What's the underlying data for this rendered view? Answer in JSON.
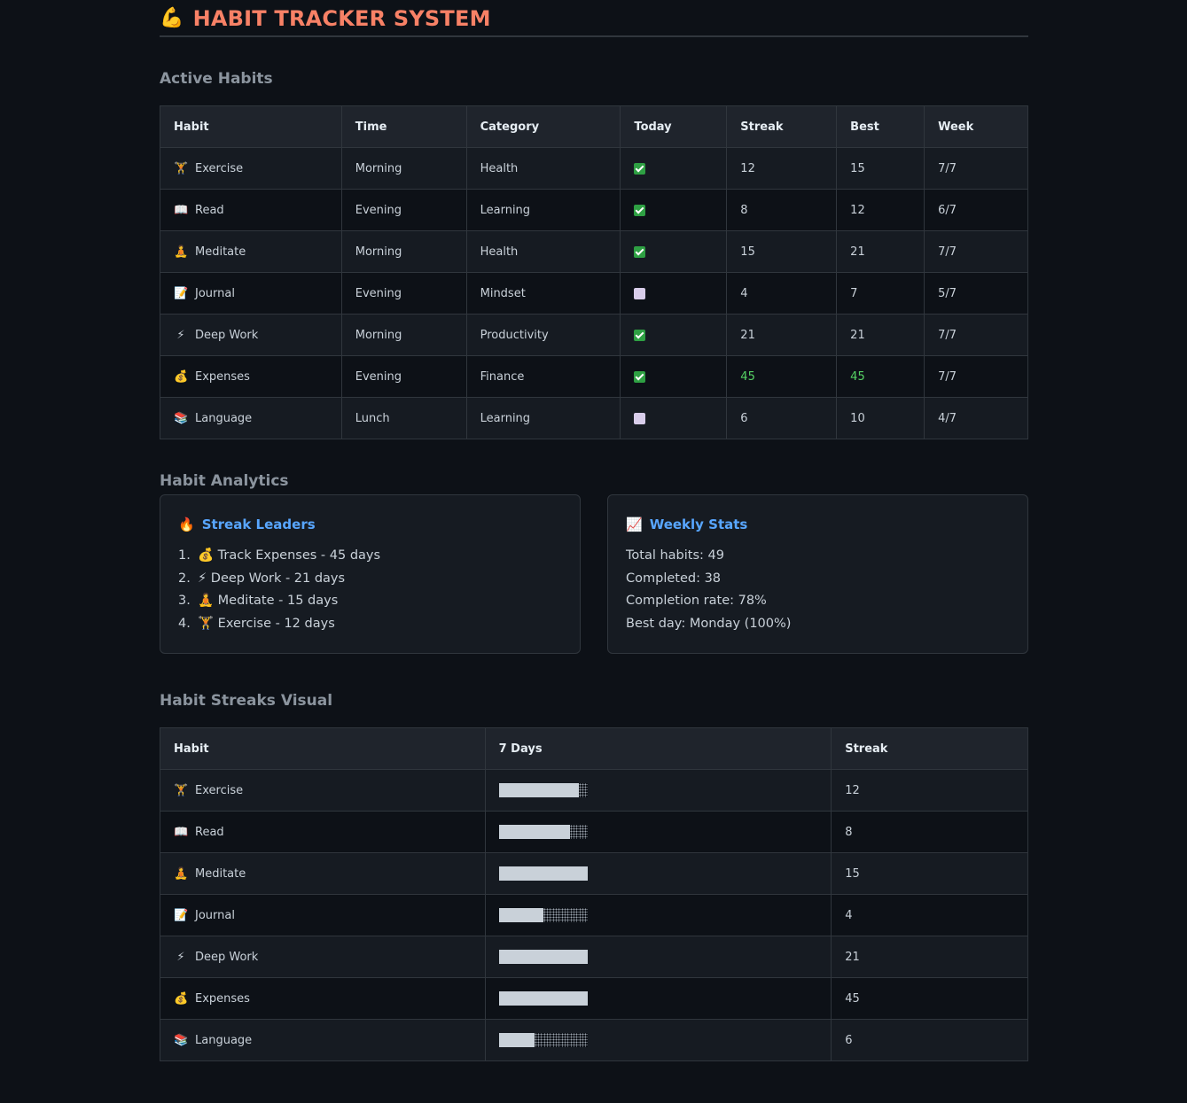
{
  "header": {
    "emoji": "💪",
    "title": "HABIT TRACKER SYSTEM"
  },
  "active_habits": {
    "section_title": "Active Habits",
    "columns": [
      "Habit",
      "Time",
      "Category",
      "Today",
      "Streak",
      "Best",
      "Week"
    ],
    "rows": [
      {
        "icon": "🏋️",
        "icon_name": "weightlifter-icon",
        "habit": "Exercise",
        "time": "Morning",
        "category": "Health",
        "today": "done",
        "streak": "12",
        "best": "15",
        "week": "7/7"
      },
      {
        "icon": "📖",
        "icon_name": "book-icon",
        "habit": "Read",
        "time": "Evening",
        "category": "Learning",
        "today": "done",
        "streak": "8",
        "best": "12",
        "week": "6/7"
      },
      {
        "icon": "🧘",
        "icon_name": "meditation-icon",
        "habit": "Meditate",
        "time": "Morning",
        "category": "Health",
        "today": "done",
        "streak": "15",
        "best": "21",
        "week": "7/7"
      },
      {
        "icon": "📝",
        "icon_name": "memo-icon",
        "habit": "Journal",
        "time": "Evening",
        "category": "Mindset",
        "today": "todo",
        "streak": "4",
        "best": "7",
        "week": "5/7"
      },
      {
        "icon": "⚡",
        "icon_name": "lightning-icon",
        "habit": "Deep Work",
        "time": "Morning",
        "category": "Productivity",
        "today": "done",
        "streak": "21",
        "best": "21",
        "week": "7/7"
      },
      {
        "icon": "💰",
        "icon_name": "money-bag-icon",
        "habit": "Expenses",
        "time": "Evening",
        "category": "Finance",
        "today": "done",
        "streak": "45",
        "best": "45",
        "week": "7/7",
        "highlight": true
      },
      {
        "icon": "📚",
        "icon_name": "books-icon",
        "habit": "Language",
        "time": "Lunch",
        "category": "Learning",
        "today": "todo",
        "streak": "6",
        "best": "10",
        "week": "4/7"
      }
    ]
  },
  "analytics": {
    "section_title": "Habit Analytics",
    "streak_leaders": {
      "icon": "🔥",
      "title": "Streak Leaders",
      "items": [
        {
          "num": "1.",
          "icon": "💰",
          "icon_name": "money-bag-icon",
          "text": "Track Expenses - 45 days"
        },
        {
          "num": "2.",
          "icon": "⚡",
          "icon_name": "lightning-icon",
          "text": "Deep Work - 21 days"
        },
        {
          "num": "3.",
          "icon": "🧘",
          "icon_name": "meditation-icon",
          "text": "Meditate - 15 days"
        },
        {
          "num": "4.",
          "icon": "🏋️",
          "icon_name": "weightlifter-icon",
          "text": "Exercise - 12 days"
        }
      ]
    },
    "weekly_stats": {
      "icon": "📈",
      "title": "Weekly Stats",
      "lines": [
        "Total habits: 49",
        "Completed: 38",
        "Completion rate: 78%",
        "Best day: Monday (100%)"
      ]
    }
  },
  "streaks_visual": {
    "section_title": "Habit Streaks Visual",
    "columns": [
      "Habit",
      "7 Days",
      "Streak"
    ],
    "rows": [
      {
        "icon": "🏋️",
        "icon_name": "weightlifter-icon",
        "habit": "Exercise",
        "filled": 9,
        "total": 10,
        "streak": "12"
      },
      {
        "icon": "📖",
        "icon_name": "book-icon",
        "habit": "Read",
        "filled": 8,
        "total": 10,
        "streak": "8"
      },
      {
        "icon": "🧘",
        "icon_name": "meditation-icon",
        "habit": "Meditate",
        "filled": 10,
        "total": 10,
        "streak": "15"
      },
      {
        "icon": "📝",
        "icon_name": "memo-icon",
        "habit": "Journal",
        "filled": 5,
        "total": 10,
        "streak": "4"
      },
      {
        "icon": "⚡",
        "icon_name": "lightning-icon",
        "habit": "Deep Work",
        "filled": 10,
        "total": 10,
        "streak": "21"
      },
      {
        "icon": "💰",
        "icon_name": "money-bag-icon",
        "habit": "Expenses",
        "filled": 10,
        "total": 10,
        "streak": "45"
      },
      {
        "icon": "📚",
        "icon_name": "books-icon",
        "habit": "Language",
        "filled": 4,
        "total": 10,
        "streak": "6"
      }
    ]
  },
  "colors": {
    "background": "#0d1117",
    "title": "#f78166",
    "card_title": "#58a6ff",
    "highlight": "#56d364",
    "check_done": "#2ea043",
    "check_todo": "#d8cdea"
  }
}
